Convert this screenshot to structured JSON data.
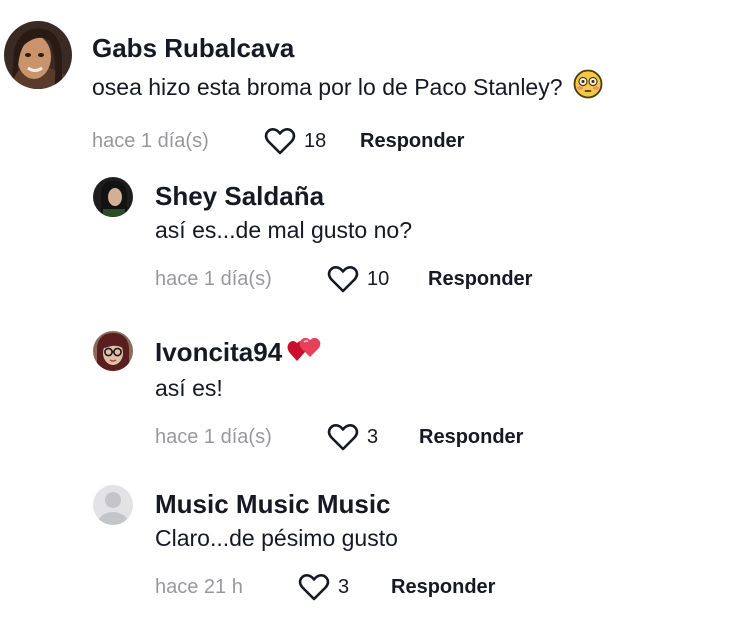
{
  "comments": [
    {
      "username": "Gabs Rubalcava",
      "text": "osea hizo esta broma por lo de Paco Stanley?",
      "time": "hace 1 día(s)",
      "likes": "18",
      "reply_label": "Responder",
      "emoji": "flushed-face-emoji"
    },
    {
      "username": "Shey Saldaña",
      "text": "así es...de mal gusto no?",
      "time": "hace 1 día(s)",
      "likes": "10",
      "reply_label": "Responder"
    },
    {
      "username": "Ivoncita94",
      "text": "así es!",
      "time": "hace 1 día(s)",
      "likes": "3",
      "reply_label": "Responder",
      "username_emoji": "two-hearts-emoji"
    },
    {
      "username": "Music Music Music",
      "text": "Claro...de pésimo gusto",
      "time": "hace 21 h",
      "likes": "3",
      "reply_label": "Responder"
    }
  ],
  "colors": {
    "text": "#161823",
    "muted": "#9a9ba0",
    "heart_emoji": "#e0245e",
    "emoji_yellow": "#f7c844"
  }
}
